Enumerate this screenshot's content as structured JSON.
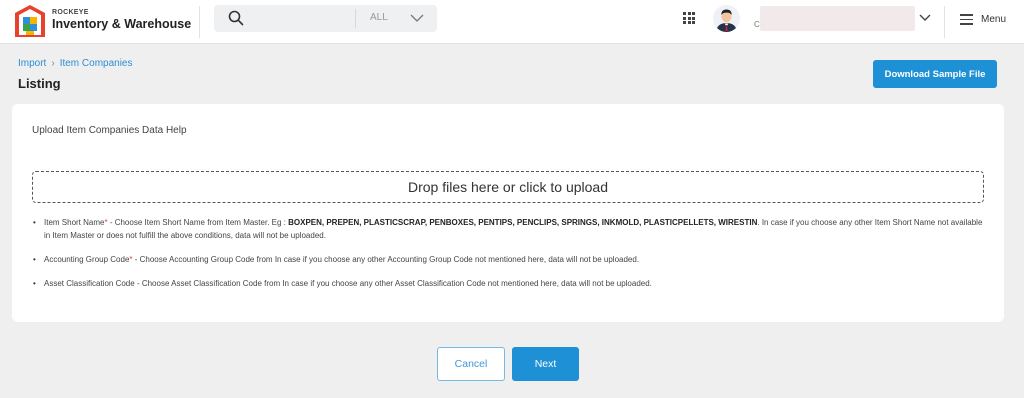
{
  "header": {
    "brand_small": "ROCKEYE",
    "brand_name": "Inventory & Warehouse",
    "search": {
      "value": "",
      "placeholder": ""
    },
    "scope": "ALL",
    "user_initial": "C",
    "menu_label": "Menu",
    "icons": [
      "logo-icon",
      "search-icon",
      "chevron-down-icon",
      "apps-grid-icon",
      "avatar",
      "menu-icon"
    ]
  },
  "breadcrumb": [
    {
      "label": "Import"
    },
    {
      "label": "Item Companies"
    }
  ],
  "page_title": "Listing",
  "download_label": "Download Sample File",
  "card": {
    "title": "Upload Item Companies Data Help",
    "dropzone_text": "Drop files here or click to upload",
    "help": [
      {
        "field": "Item Short Name",
        "required": "*",
        "text_before": " - Choose Item Short Name from Item Master. Eg : ",
        "codes": "BOXPEN, PREPEN, PLASTICSCRAP, PENBOXES, PENTIPS, PENCLIPS, SPRINGS, INKMOLD, PLASTICPELLETS, WIRESTIN",
        "text_after": ". In case if you choose any other Item Short Name not available in Item Master or does not fulfill the above conditions, data will not be uploaded."
      },
      {
        "field": "Accounting Group Code",
        "required": "*",
        "text_after": " - Choose Accounting Group Code from In case if you choose any other Accounting Group Code not mentioned here, data will not be uploaded."
      },
      {
        "field": "Asset Classification Code",
        "text_after": " - Choose Asset Classification Code from In case if you choose any other Asset Classification Code not mentioned here, data will not be uploaded."
      }
    ]
  },
  "actions": {
    "cancel_label": "Cancel",
    "next_label": "Next"
  },
  "colors": {
    "primary": "#1e91d6",
    "link": "#2b8ed6",
    "required": "#e53935",
    "background": "#efefef"
  }
}
